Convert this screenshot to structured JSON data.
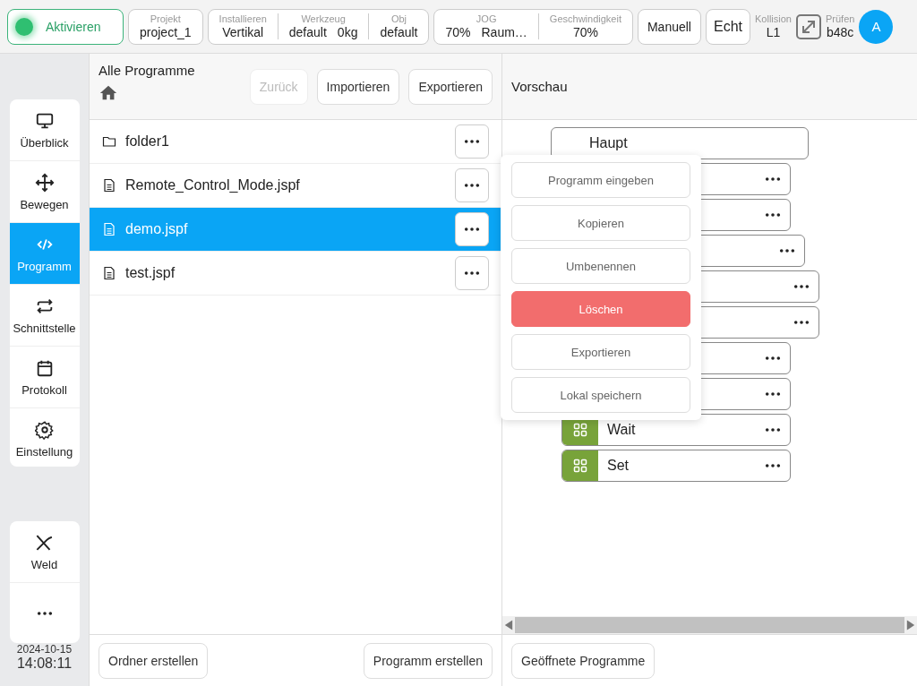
{
  "topbar": {
    "activate": {
      "label": "Aktivieren",
      "on": true
    },
    "groups": [
      [
        {
          "label": "Projekt",
          "values": [
            "project_1"
          ]
        }
      ],
      [
        {
          "label": "Installieren",
          "values": [
            "Vertikal"
          ]
        },
        {
          "label": "Werkzeug",
          "values": [
            "default",
            "0kg"
          ]
        },
        {
          "label": "Obj",
          "values": [
            "default"
          ]
        }
      ],
      [
        {
          "label": "JOG",
          "values": [
            "70%",
            "Raum…"
          ]
        },
        {
          "label": "Geschwindigkeit",
          "values": [
            "70%"
          ]
        }
      ]
    ],
    "mode_buttons": [
      "Manuell",
      "Echt"
    ],
    "collision": {
      "label": "Kollision",
      "value": "L1"
    },
    "check": {
      "label": "Prüfen",
      "value": "b48c"
    },
    "avatar": "A"
  },
  "sidebar": {
    "items": [
      {
        "label": "Überblick",
        "selected": false
      },
      {
        "label": "Bewegen",
        "selected": false
      },
      {
        "label": "Programm",
        "selected": true
      },
      {
        "label": "Schnittstelle",
        "selected": false
      },
      {
        "label": "Protokoll",
        "selected": false
      },
      {
        "label": "Einstellung",
        "selected": false
      }
    ],
    "extra": {
      "label": "Weld"
    },
    "date": "2024-10-15",
    "time": "14:08:11"
  },
  "programs": {
    "title": "Alle Programme",
    "buttons": [
      {
        "label": "Zurück",
        "disabled": true
      },
      {
        "label": "Importieren",
        "disabled": false
      },
      {
        "label": "Exportieren",
        "disabled": false
      }
    ],
    "files": [
      {
        "kind": "folder",
        "name": "folder1",
        "selected": false
      },
      {
        "kind": "file",
        "name": "Remote_Control_Mode.jspf",
        "selected": false
      },
      {
        "kind": "file",
        "name": "demo.jspf",
        "selected": true
      },
      {
        "kind": "file",
        "name": "test.jspf",
        "selected": false
      }
    ],
    "menu": [
      {
        "label": "Programm eingeben",
        "kind": "normal"
      },
      {
        "label": "Kopieren",
        "kind": "normal"
      },
      {
        "label": "Umbenennen",
        "kind": "normal"
      },
      {
        "label": "Löschen",
        "kind": "danger"
      },
      {
        "label": "Exportieren",
        "kind": "normal"
      },
      {
        "label": "Lokal speichern",
        "kind": "normal"
      }
    ],
    "footer": [
      "Ordner erstellen",
      "Programm erstellen"
    ]
  },
  "preview": {
    "title": "Vorschau",
    "root": "Haupt",
    "nodes": [
      {
        "kind": "block"
      },
      {
        "kind": "block",
        "children": [
          {
            "kind": "block",
            "children": [
              {
                "kind": "block"
              },
              {
                "kind": "block"
              }
            ]
          }
        ]
      },
      {
        "kind": "block"
      },
      {
        "kind": "block"
      },
      {
        "kind": "block",
        "label": "Wait"
      },
      {
        "kind": "block",
        "label": "Set"
      }
    ],
    "footer": "Geöffnete Programme"
  }
}
